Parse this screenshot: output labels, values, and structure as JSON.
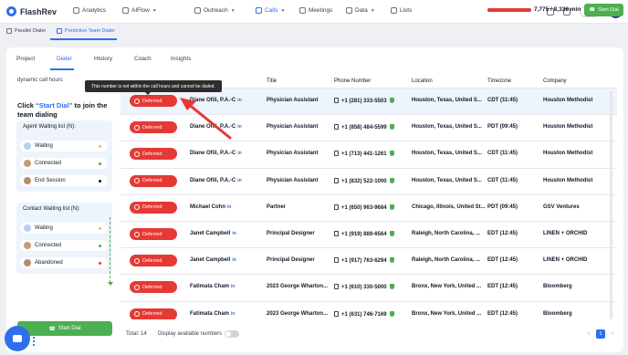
{
  "app": {
    "name": "FlashRev"
  },
  "nav": {
    "items": [
      "Analytics",
      "AIFlow",
      "Outreach",
      "Calls",
      "Meetings",
      "Data",
      "Lists"
    ],
    "active": "Calls",
    "balance": "7.9M",
    "avatar": "OD"
  },
  "subtabs": [
    "Parallel Dialer",
    "Predictive Team Dialer"
  ],
  "tabs": [
    "Project",
    "Dialer",
    "History",
    "Coach",
    "Insights"
  ],
  "dialer": {
    "progress_fraction": 0.93,
    "minutes": "7,775 / 8,338 min",
    "start_label": "Start Dial"
  },
  "sidebar": {
    "filter": "dynamic call hours",
    "click_prefix": "Click ",
    "click_hl": "“Start Dial”",
    "click_suffix": " to join the team dialing",
    "agent_title": "Agent Waiting list (N):",
    "agent_items": [
      {
        "label": "Waiting",
        "dot": "#e5c04a"
      },
      {
        "label": "Connected",
        "dot": "#4caf50"
      },
      {
        "label": "End Session",
        "dot": "#111827"
      }
    ],
    "contact_title": "Contact Waiting list (N):",
    "contact_items": [
      {
        "label": "Waiting",
        "dot": "#e5c04a"
      },
      {
        "label": "Connected",
        "dot": "#4caf50"
      },
      {
        "label": "Abandoned",
        "dot": "#e53935"
      }
    ],
    "start_label": "Start Dial"
  },
  "table": {
    "headers": [
      "Title",
      "Phone Number",
      "Location",
      "Timezone",
      "Company"
    ],
    "status_label": "Deferred",
    "rows": [
      {
        "name": "Diane Ofili, P.A.-C",
        "title": "Physician Assistant",
        "phone": "+1 (281) 333-5503",
        "location": "Houston, Texas, United S...",
        "tz": "CDT (11:45)",
        "company": "Houston Methodist"
      },
      {
        "name": "Diane Ofili, P.A.-C",
        "title": "Physician Assistant",
        "phone": "+1 (858) 484-5599",
        "location": "Houston, Texas, United S...",
        "tz": "PDT (09:45)",
        "company": "Houston Methodist"
      },
      {
        "name": "Diane Ofili, P.A.-C",
        "title": "Physician Assistant",
        "phone": "+1 (713) 441-1261",
        "location": "Houston, Texas, United S...",
        "tz": "CDT (11:45)",
        "company": "Houston Methodist"
      },
      {
        "name": "Diane Ofili, P.A.-C",
        "title": "Physician Assistant",
        "phone": "+1 (832) 522-1000",
        "location": "Houston, Texas, United S...",
        "tz": "CDT (11:45)",
        "company": "Houston Methodist"
      },
      {
        "name": "Michael Cohn",
        "title": "Partner",
        "phone": "+1 (650) 963-9684",
        "location": "Chicago, Illinois, United St...",
        "tz": "PDT (09:45)",
        "company": "GSV Ventures"
      },
      {
        "name": "Janet Campbell",
        "title": "Principal Designer",
        "phone": "+1 (919) 889-6564",
        "location": "Raleigh, North Carolina, ...",
        "tz": "EDT (12:45)",
        "company": "LINEN + ORCHID"
      },
      {
        "name": "Janet Campbell",
        "title": "Principal Designer",
        "phone": "+1 (917) 763-6294",
        "location": "Raleigh, North Carolina, ...",
        "tz": "EDT (12:45)",
        "company": "LINEN + ORCHID"
      },
      {
        "name": "Fatimata Cham",
        "title": "2023 George Wharton...",
        "phone": "+1 (610) 330-5000",
        "location": "Bronx, New York, United ...",
        "tz": "EDT (12:45)",
        "company": "Bloomberg"
      },
      {
        "name": "Fatimata Cham",
        "title": "2023 George Wharton...",
        "phone": "+1 (631) 746-7169",
        "location": "Bronx, New York, United ...",
        "tz": "EDT (12:45)",
        "company": "Bloomberg"
      }
    ]
  },
  "tooltip": "This number is not within the call hours and cannot be dialed.",
  "footer": {
    "total": "Total: 14",
    "display": "Display available numbers",
    "page": "1",
    "prev": "<",
    "next": ">"
  }
}
